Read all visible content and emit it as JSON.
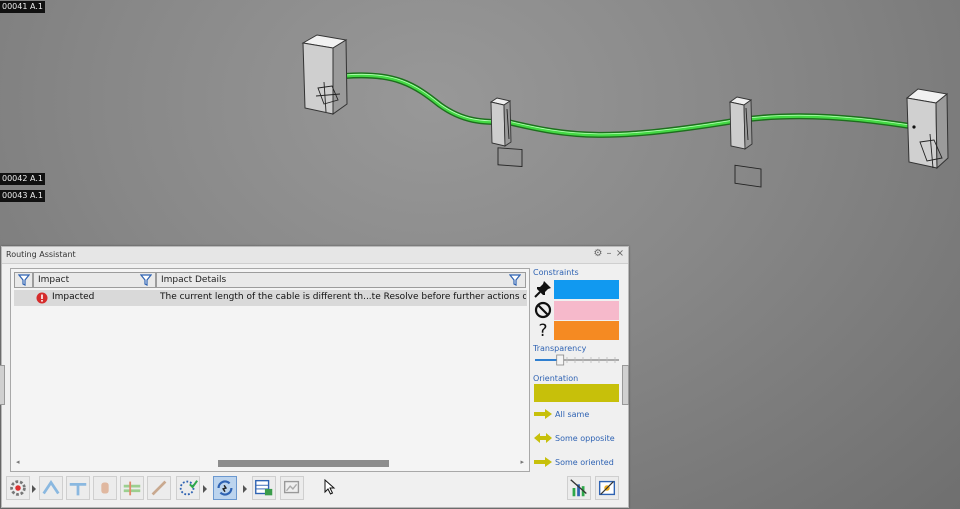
{
  "viewport": {
    "labels": [
      "00041 A.1",
      "00042 A.1",
      "00043 A.1"
    ]
  },
  "panel": {
    "title": "Routing Assistant",
    "controls": {
      "settings": "⚙",
      "minimize": "–",
      "close": "×"
    }
  },
  "table": {
    "columns": [
      "Impact",
      "Impact Details"
    ],
    "rows": [
      {
        "impact": "Impacted",
        "details": "The current length of the cable is different th...te Resolve before further actions on this cable."
      }
    ]
  },
  "sidebar": {
    "constraints_label": "Constraints",
    "constraints": [
      {
        "icon": "pin-icon",
        "color": "#1199f0"
      },
      {
        "icon": "no-entry-icon",
        "color": "#f6b9cb"
      },
      {
        "icon": "question-icon",
        "color": "#f58a22"
      }
    ],
    "transparency_label": "Transparency",
    "transparency_level": 0.3,
    "orientation_label": "Orientation",
    "orientation_color": "#c7c00a",
    "legend": [
      {
        "icon": "right-arrow-icon",
        "label": "All same"
      },
      {
        "icon": "double-arrow-icon",
        "label": "Some opposite"
      },
      {
        "icon": "right-arrow-icon",
        "label": "Some oriented"
      }
    ]
  },
  "colors": {
    "cable": "#3fd23f",
    "accent_blue": "#2f63b3",
    "orientation_yellow": "#c7c00a"
  }
}
